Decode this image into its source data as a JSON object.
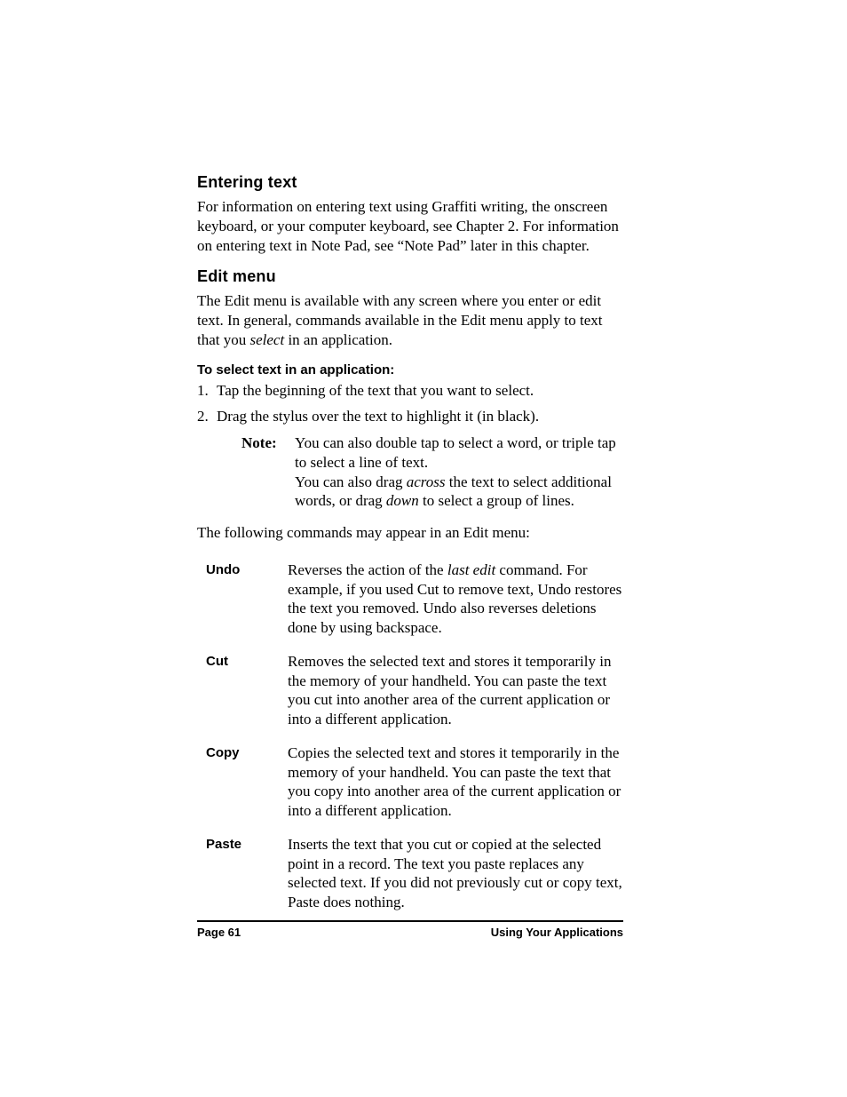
{
  "sections": {
    "entering": {
      "heading": "Entering text",
      "body": "For information on entering text using Graffiti writing, the onscreen keyboard, or your computer keyboard, see Chapter 2. For information on entering text in Note Pad, see “Note Pad” later in this chapter."
    },
    "editmenu": {
      "heading": "Edit menu",
      "body_pre": "The Edit menu is available with any screen where you enter or edit text. In general, commands available in the Edit menu apply to text that you ",
      "body_em": "select",
      "body_post": " in an application.",
      "subheading": "To select text in an application:",
      "steps": [
        {
          "num": "1.",
          "text": "Tap the beginning of the text that you want to select."
        },
        {
          "num": "2.",
          "text": "Drag the stylus over the text to highlight it (in black)."
        }
      ],
      "note_label": "Note:",
      "note_line1": "You can also double tap to select a word, or triple tap to select a line of text.",
      "note_line2_pre": "You can also drag ",
      "note_line2_em1": "across",
      "note_line2_mid": " the text to select additional words, or drag ",
      "note_line2_em2": "down",
      "note_line2_post": " to select a group of lines.",
      "followup": "The following commands may appear in an Edit menu:"
    },
    "commands": [
      {
        "name": "Undo",
        "desc_pre": "Reverses the action of the ",
        "desc_em": "last edit",
        "desc_post": " command. For example, if you used Cut to remove text, Undo restores the text you removed. Undo also reverses deletions done by using backspace."
      },
      {
        "name": "Cut",
        "desc": "Removes the selected text and stores it temporarily in the memory of your handheld. You can paste the text you cut into another area of the current application or into a different application."
      },
      {
        "name": "Copy",
        "desc": "Copies the selected text and stores it temporarily in the memory of your handheld. You can paste the text that you copy into another area of the current application or into a different application."
      },
      {
        "name": "Paste",
        "desc": "Inserts the text that you cut or copied at the selected point in a record. The text you paste replaces any selected text. If you did not previously cut or copy text, Paste does nothing."
      }
    ]
  },
  "footer": {
    "page": "Page 61",
    "title": "Using Your Applications"
  }
}
